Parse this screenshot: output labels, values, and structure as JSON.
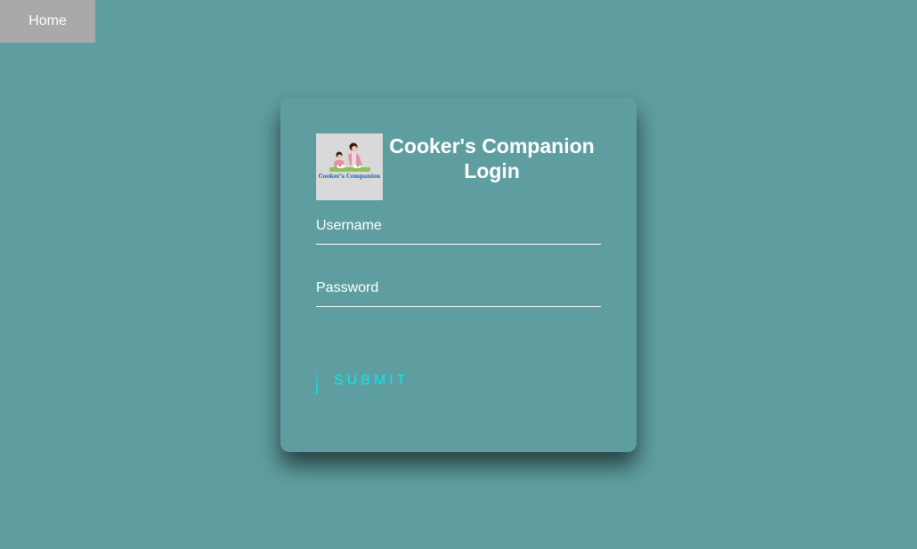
{
  "nav": {
    "home_label": "Home"
  },
  "login": {
    "title_line1": "Cooker's Companion",
    "title_line2": "Login",
    "logo_text": "Cooker's Companion",
    "username_label": "Username",
    "password_label": "Password",
    "submit_label": "SUBMIT"
  },
  "colors": {
    "background": "#5f9ea0",
    "nav_button": "#a9a9a9",
    "accent": "#03e9f4",
    "text": "#ffffff"
  }
}
